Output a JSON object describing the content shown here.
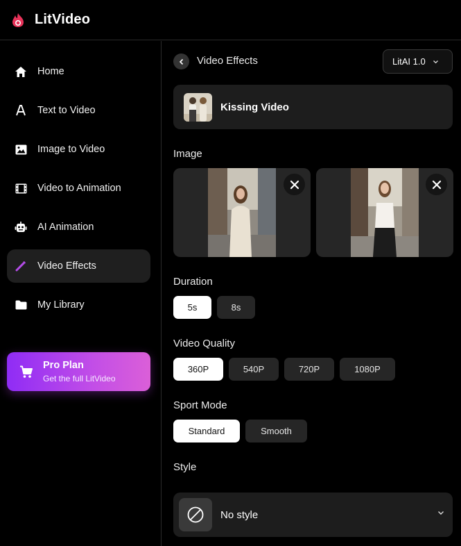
{
  "app": {
    "name": "LitVideo",
    "accent": "#b44ce8"
  },
  "sidebar": {
    "items": [
      {
        "label": "Home",
        "icon": "home-icon"
      },
      {
        "label": "Text to Video",
        "icon": "text-icon"
      },
      {
        "label": "Image to Video",
        "icon": "image-icon"
      },
      {
        "label": "Video to Animation",
        "icon": "film-icon"
      },
      {
        "label": "AI Animation",
        "icon": "robot-icon"
      },
      {
        "label": "Video Effects",
        "icon": "wand-icon",
        "active": true
      },
      {
        "label": "My Library",
        "icon": "folder-icon"
      }
    ],
    "pro": {
      "title": "Pro Plan",
      "subtitle": "Get the full LitVideo"
    }
  },
  "main": {
    "title": "Video Effects",
    "model": "LitAI 1.0",
    "effect": {
      "name": "Kissing Video"
    },
    "image_section": {
      "label": "Image"
    },
    "duration": {
      "label": "Duration",
      "options": [
        "5s",
        "8s"
      ],
      "selected": "5s"
    },
    "quality": {
      "label": "Video Quality",
      "options": [
        "360P",
        "540P",
        "720P",
        "1080P"
      ],
      "selected": "360P"
    },
    "sport_mode": {
      "label": "Sport Mode",
      "options": [
        "Standard",
        "Smooth"
      ],
      "selected": "Standard"
    },
    "style": {
      "label": "Style",
      "value": "No style"
    }
  }
}
